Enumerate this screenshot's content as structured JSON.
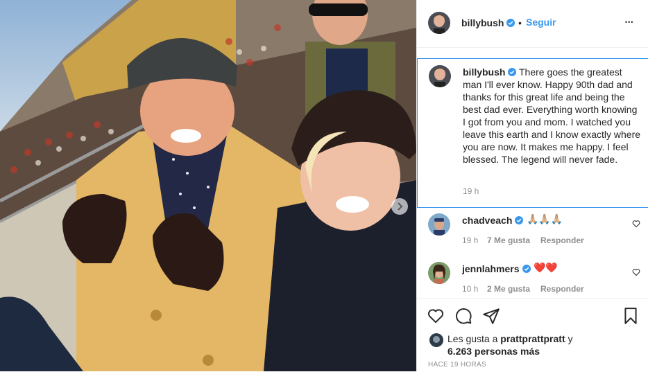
{
  "post": {
    "author": "billybush",
    "follow_label": "Seguir",
    "separator": "•",
    "more_label": "•••"
  },
  "caption": {
    "username": "billybush",
    "text": "There goes the greatest man I'll ever know. Happy 90th dad and thanks for this great life and being the best dad ever. Everything worth knowing I got from you and mom. I watched you leave this earth and I know exactly where you are now. It makes me happy. I feel blessed. The legend will never fade.",
    "time": "19 h"
  },
  "comments": [
    {
      "username": "chadveach",
      "text": "🙏🏼🙏🏼🙏🏼",
      "time": "19 h",
      "likes": "7 Me gusta",
      "reply": "Responder"
    },
    {
      "username": "jennlahmers",
      "text": "❤️❤️",
      "time": "10 h",
      "likes": "2 Me gusta",
      "reply": "Responder"
    }
  ],
  "likes": {
    "prefix": "Les gusta a",
    "user": "prattprattpratt",
    "connector": "y",
    "count": "6.263 personas más"
  },
  "posted_ago": "HACE 19 HORAS",
  "colors": {
    "accent": "#3897f0",
    "text": "#262626",
    "muted": "#8e8e8e",
    "border": "#efefef"
  },
  "icons": [
    "verified-badge-icon",
    "more-options-icon",
    "heart-icon",
    "comment-icon",
    "share-icon",
    "bookmark-icon",
    "chevron-right-icon"
  ]
}
